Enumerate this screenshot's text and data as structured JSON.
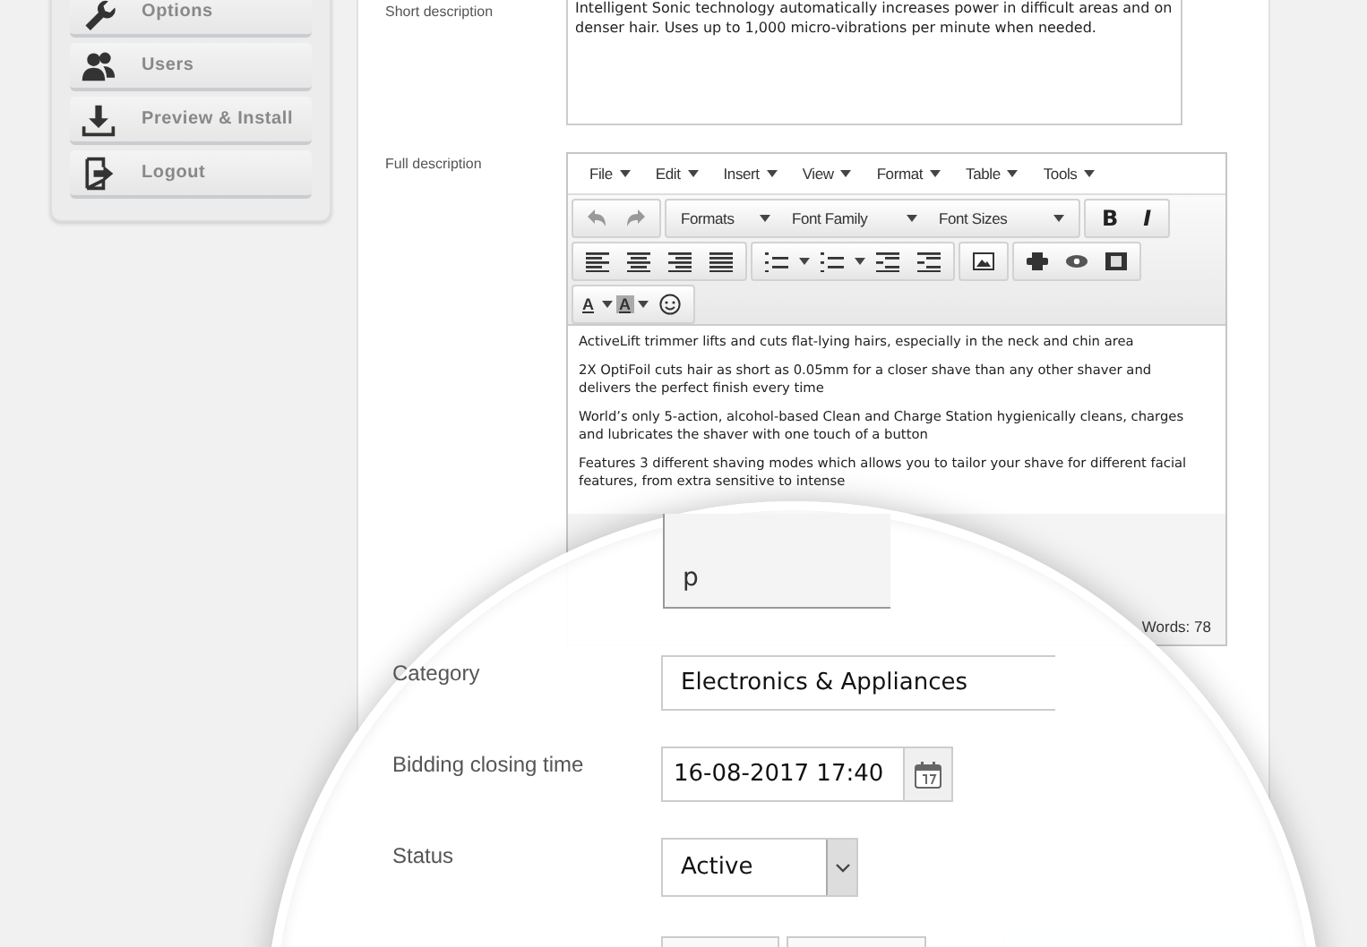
{
  "sidebar": {
    "items": [
      {
        "label": "Options"
      },
      {
        "label": "Users"
      },
      {
        "label": "Preview & Install"
      },
      {
        "label": "Logout"
      }
    ]
  },
  "short_description": {
    "label": "Short description",
    "value": "Intelligent Sonic technology automatically increases power in difficult areas and on denser hair. Uses up to 1,000 micro-vibrations per minute when needed."
  },
  "full_description": {
    "label": "Full description",
    "menubar": [
      "File",
      "Edit",
      "Insert",
      "View",
      "Format",
      "Table",
      "Tools"
    ],
    "dropdowns": [
      "Formats",
      "Font Family",
      "Font Sizes"
    ],
    "bold_label": "B",
    "italic_label": "I",
    "text_color_label": "A",
    "highlight_label": "A",
    "paragraphs": [
      "ActiveLift trimmer lifts and cuts flat-lying hairs, especially in the neck and chin area",
      "2X OptiFoil cuts hair as short as 0.05mm for a closer shave than any other shaver and delivers the perfect finish every time",
      "World’s only 5-action, alcohol-based Clean and Charge Station hygienically cleans, charges and lubricates the shaver with one touch of a button",
      "Features 3 different shaving modes which allows you to tailor your shave for different facial features, from extra sensitive to intense"
    ],
    "path": "p",
    "word_count": "Words: 78"
  },
  "category": {
    "label": "Category",
    "value": "Electronics & Appliances"
  },
  "closing_time": {
    "label": "Bidding closing time",
    "value": "16-08-2017 17:40"
  },
  "status": {
    "label": "Status",
    "value": "Active"
  }
}
